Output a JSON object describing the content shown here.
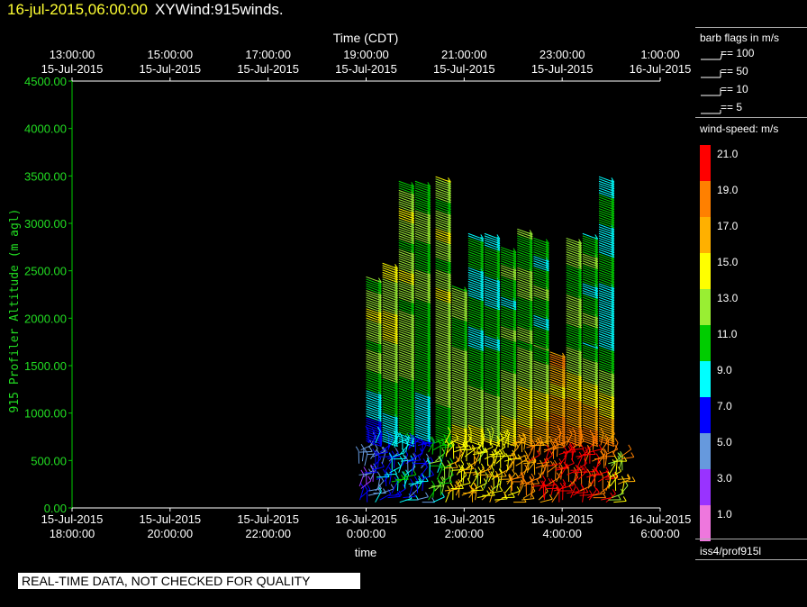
{
  "header": {
    "timestamp": "16-jul-2015,06:00:00",
    "product": "XYWind:915winds."
  },
  "legend": {
    "barb_title": "barb flags in m/s",
    "barbs": [
      {
        "label": "== 100"
      },
      {
        "label": "== 50"
      },
      {
        "label": "== 10"
      },
      {
        "label": "== 5"
      }
    ],
    "speed_title": "wind-speed: m/s",
    "colors": [
      {
        "label": "21.0",
        "color": "#ff0000"
      },
      {
        "label": "19.0",
        "color": "#ff8000"
      },
      {
        "label": "17.0",
        "color": "#ffb000"
      },
      {
        "label": "15.0",
        "color": "#ffff00"
      },
      {
        "label": "13.0",
        "color": "#99ee33"
      },
      {
        "label": "11.0",
        "color": "#00cc00"
      },
      {
        "label": "9.0",
        "color": "#00ffff"
      },
      {
        "label": "7.0",
        "color": "#0000ff"
      },
      {
        "label": "5.0",
        "color": "#6699dd"
      },
      {
        "label": "3.0",
        "color": "#9933ff"
      },
      {
        "label": "1.0",
        "color": "#ee77dd"
      }
    ],
    "source": "iss4/prof915l"
  },
  "banner": "REAL-TIME DATA, NOT CHECKED FOR QUALITY",
  "chart_data": {
    "type": "scatter",
    "title": "Time (CDT)",
    "xlabel": "time",
    "ylabel": "915 Profiler Altitude (m agl)",
    "ylim": [
      0,
      4500
    ],
    "xlim": [
      "15-Jul-2015 18:00:00",
      "16-Jul-2015 06:00:00"
    ],
    "y_ticks": [
      "0.00",
      "500.00",
      "1000.00",
      "1500.00",
      "2000.00",
      "2500.00",
      "3000.00",
      "3500.00",
      "4000.00",
      "4500.00"
    ],
    "x_ticks_bottom": [
      {
        "date": "15-Jul-2015",
        "time": "18:00:00"
      },
      {
        "date": "15-Jul-2015",
        "time": "20:00:00"
      },
      {
        "date": "15-Jul-2015",
        "time": "22:00:00"
      },
      {
        "date": "16-Jul-2015",
        "time": "0:00:00"
      },
      {
        "date": "16-Jul-2015",
        "time": "2:00:00"
      },
      {
        "date": "16-Jul-2015",
        "time": "4:00:00"
      },
      {
        "date": "16-Jul-2015",
        "time": "6:00:00"
      }
    ],
    "x_ticks_top": [
      {
        "time": "13:00:00",
        "date": "15-Jul-2015"
      },
      {
        "time": "15:00:00",
        "date": "15-Jul-2015"
      },
      {
        "time": "17:00:00",
        "date": "15-Jul-2015"
      },
      {
        "time": "19:00:00",
        "date": "15-Jul-2015"
      },
      {
        "time": "21:00:00",
        "date": "15-Jul-2015"
      },
      {
        "time": "23:00:00",
        "date": "15-Jul-2015"
      },
      {
        "time": "1:00:00",
        "date": "16-Jul-2015"
      }
    ],
    "profiles": [
      {
        "time": "16-Jul-2015 00:00",
        "top": 2450,
        "upper_speed": 13,
        "low_speed": 5
      },
      {
        "time": "16-Jul-2015 00:20",
        "top": 2600,
        "upper_speed": 14,
        "low_speed": 7
      },
      {
        "time": "16-Jul-2015 00:40",
        "top": 3450,
        "upper_speed": 13,
        "low_speed": 9
      },
      {
        "time": "16-Jul-2015 01:00",
        "top": 3450,
        "upper_speed": 12,
        "low_speed": 7
      },
      {
        "time": "16-Jul-2015 01:25",
        "top": 3500,
        "upper_speed": 13,
        "low_speed": 11
      },
      {
        "time": "16-Jul-2015 01:45",
        "top": 2350,
        "upper_speed": 12,
        "low_speed": 15
      },
      {
        "time": "16-Jul-2015 02:05",
        "top": 2900,
        "upper_speed": 10,
        "low_speed": 16
      },
      {
        "time": "16-Jul-2015 02:25",
        "top": 2900,
        "upper_speed": 10,
        "low_speed": 15
      },
      {
        "time": "16-Jul-2015 02:45",
        "top": 2750,
        "upper_speed": 11,
        "low_speed": 16
      },
      {
        "time": "16-Jul-2015 03:05",
        "top": 2950,
        "upper_speed": 12,
        "low_speed": 18
      },
      {
        "time": "16-Jul-2015 03:25",
        "top": 2850,
        "upper_speed": 11,
        "low_speed": 19
      },
      {
        "time": "16-Jul-2015 03:45",
        "top": 1650,
        "upper_speed": 17,
        "low_speed": 20
      },
      {
        "time": "16-Jul-2015 04:05",
        "top": 2850,
        "upper_speed": 12,
        "low_speed": 21
      },
      {
        "time": "16-Jul-2015 04:25",
        "top": 2900,
        "upper_speed": 11,
        "low_speed": 21
      },
      {
        "time": "16-Jul-2015 04:45",
        "top": 3500,
        "upper_speed": 10,
        "low_speed": 20
      },
      {
        "time": "16-Jul-2015 05:05",
        "top": 600,
        "upper_speed": 17,
        "low_speed": 15
      }
    ]
  }
}
